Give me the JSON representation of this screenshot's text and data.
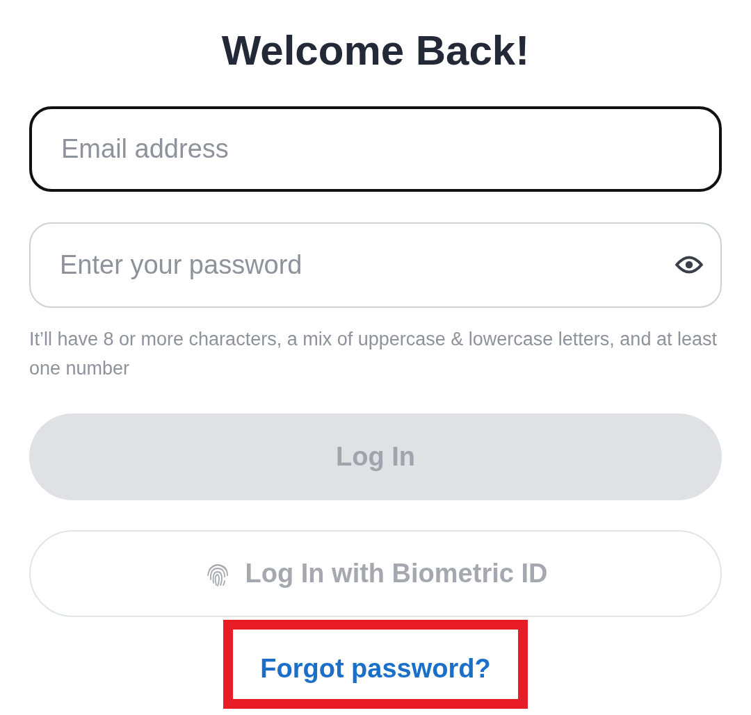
{
  "title": "Welcome Back!",
  "email_field": {
    "placeholder": "Email address",
    "focused": true
  },
  "password_field": {
    "placeholder": "Enter your password",
    "focused": false
  },
  "password_hint": "It’ll have 8 or more characters, a mix of uppercase & lowercase letters, and at least one number",
  "login_button": {
    "label": "Log In",
    "disabled": true
  },
  "biometric_button": {
    "label": "Log In with Biometric ID",
    "disabled": true
  },
  "forgot_link": {
    "label": "Forgot password?",
    "highlighted": true
  }
}
